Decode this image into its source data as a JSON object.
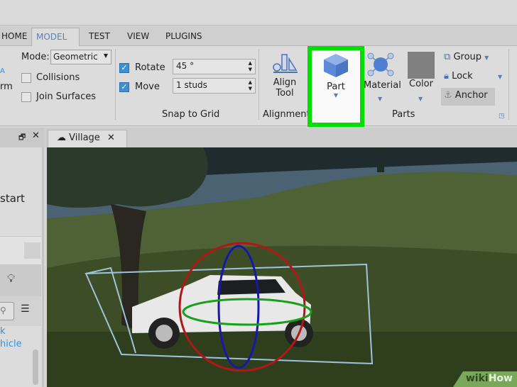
{
  "tabs": [
    "HOME",
    "MODEL",
    "TEST",
    "VIEW",
    "PLUGINS"
  ],
  "active_tab": "MODEL",
  "transform": {
    "partial_label": "rm"
  },
  "mode": {
    "label": "Mode:",
    "value": "Geometric"
  },
  "collisions": {
    "label": "Collisions",
    "checked": false
  },
  "join_surfaces": {
    "label": "Join Surfaces",
    "checked": false
  },
  "snap": {
    "rotate_label": "Rotate",
    "rotate_value": "45 °",
    "move_label": "Move",
    "move_value": "1 studs",
    "group_label": "Snap to Grid"
  },
  "alignment": {
    "tool_line1": "Align",
    "tool_line2": "Tool",
    "group_label": "Alignment"
  },
  "parts": {
    "part": "Part",
    "material": "Material",
    "color": "Color",
    "group": "Group",
    "lock": "Lock",
    "anchor": "Anchor",
    "group_label": "Parts",
    "color_swatch": "#808080"
  },
  "document_tab": "Village",
  "left_panel": {
    "text_start": "start",
    "link1": "k",
    "link2": "hicle"
  },
  "watermark": {
    "wiki": "wiki",
    "how": "How"
  },
  "highlight_color": "#00e000"
}
